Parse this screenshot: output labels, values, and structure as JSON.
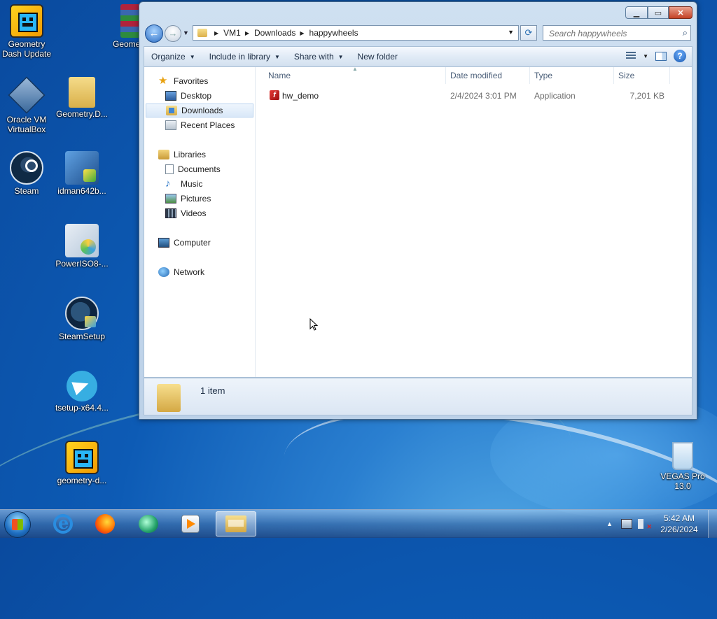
{
  "desktop": {
    "icons": [
      {
        "label": "Geometry Dash Update"
      },
      {
        "label": "Geome"
      },
      {
        "label": "Oracle VM VirtualBox"
      },
      {
        "label": "Geometry.D..."
      },
      {
        "label": "Steam"
      },
      {
        "label": "idman642b..."
      },
      {
        "label": "PowerISO8-..."
      },
      {
        "label": "SteamSetup"
      },
      {
        "label": "tsetup-x64.4..."
      },
      {
        "label": "geometry-d..."
      },
      {
        "label": "VEGAS Pro 13.0"
      }
    ]
  },
  "explorer": {
    "address": {
      "crumbs": [
        "VM1",
        "Downloads",
        "happywheels"
      ]
    },
    "search": {
      "placeholder": "Search happywheels"
    },
    "toolbar": {
      "organize": "Organize",
      "include_in_library": "Include in library",
      "share_with": "Share with",
      "new_folder": "New folder"
    },
    "nav": {
      "favorites": "Favorites",
      "desktop": "Desktop",
      "downloads": "Downloads",
      "recent_places": "Recent Places",
      "libraries": "Libraries",
      "documents": "Documents",
      "music": "Music",
      "pictures": "Pictures",
      "videos": "Videos",
      "computer": "Computer",
      "network": "Network"
    },
    "columns": {
      "name": "Name",
      "date_modified": "Date modified",
      "type": "Type",
      "size": "Size"
    },
    "files": [
      {
        "name": "hw_demo",
        "date_modified": "2/4/2024 3:01 PM",
        "type": "Application",
        "size": "7,201 KB"
      }
    ],
    "details": {
      "count_text": "1 item"
    }
  },
  "taskbar": {
    "clock": {
      "time": "5:42 AM",
      "date": "2/26/2024"
    }
  }
}
